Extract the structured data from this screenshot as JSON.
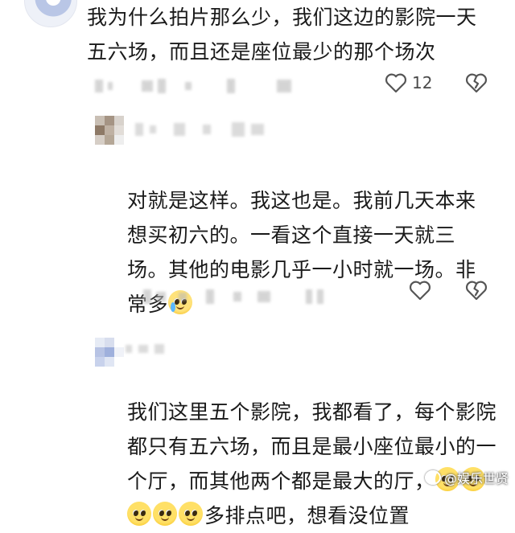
{
  "comments": [
    {
      "text": "我为什么拍片那么少，我们这边的影院一天五六场，而且还是座位最少的那个场次",
      "like_count": "12",
      "icons": {
        "like": "heart-outline-icon",
        "dislike": "broken-heart-icon"
      }
    },
    {
      "text_main": "对就是这样。我这也是。我前几天本来想买初六的。一看这个直接一天就三场。其他的电影几乎一小时就一场。非常多",
      "emoji": "crying-laughing-emoji",
      "icons": {
        "like": "heart-outline-icon",
        "dislike": "broken-heart-icon"
      }
    },
    {
      "text_main": "我们这里五个影院，我都看了，每个影院都只有五六场，而且是最小座位最小的一个厅，而其他两个都是最大的厅，",
      "emojis": [
        "pleading-face-emoji",
        "pleading-face-emoji",
        "pleading-face-emoji",
        "pleading-face-emoji",
        "pleading-face-emoji"
      ],
      "text_tail": "多排点吧，想看没位置"
    }
  ],
  "watermark": {
    "text": "@娱乐世贤",
    "logo": "weibo-logo-icon"
  },
  "colors": {
    "text": "#1a1a1a",
    "icon": "#555555",
    "blur": "#cfcfcf"
  }
}
